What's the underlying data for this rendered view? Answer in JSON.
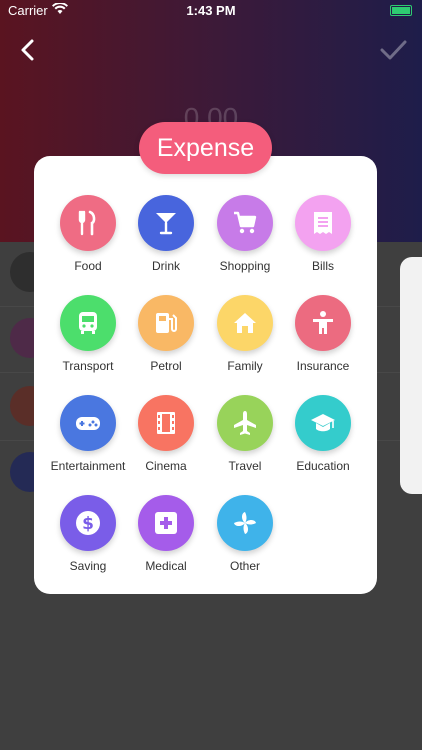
{
  "status_bar": {
    "carrier": "Carrier",
    "time": "1:43 PM"
  },
  "background": {
    "amount": "0.00"
  },
  "modal": {
    "title": "Expense",
    "title_color": "#f45d7c",
    "categories": [
      {
        "label": "Food",
        "color": "#ef6c84",
        "icon": "fork-knife-icon"
      },
      {
        "label": "Drink",
        "color": "#4865dd",
        "icon": "cocktail-icon"
      },
      {
        "label": "Shopping",
        "color": "#c77be8",
        "icon": "cart-icon"
      },
      {
        "label": "Bills",
        "color": "#f3a2f0",
        "icon": "receipt-icon"
      },
      {
        "label": "Transport",
        "color": "#4cde6c",
        "icon": "bus-icon"
      },
      {
        "label": "Petrol",
        "color": "#f9b865",
        "icon": "fuel-pump-icon"
      },
      {
        "label": "Family",
        "color": "#fcd668",
        "icon": "home-icon"
      },
      {
        "label": "Insurance",
        "color": "#ec6b80",
        "icon": "person-icon"
      },
      {
        "label": "Entertainment",
        "color": "#4a77e0",
        "icon": "gamepad-icon"
      },
      {
        "label": "Cinema",
        "color": "#f87462",
        "icon": "film-icon"
      },
      {
        "label": "Travel",
        "color": "#98d35a",
        "icon": "airplane-icon"
      },
      {
        "label": "Education",
        "color": "#34cccc",
        "icon": "graduation-cap-icon"
      },
      {
        "label": "Saving",
        "color": "#7a5de8",
        "icon": "dollar-coin-icon"
      },
      {
        "label": "Medical",
        "color": "#a55cea",
        "icon": "medical-cross-icon"
      },
      {
        "label": "Other",
        "color": "#3fb3ea",
        "icon": "pinwheel-icon"
      }
    ]
  }
}
